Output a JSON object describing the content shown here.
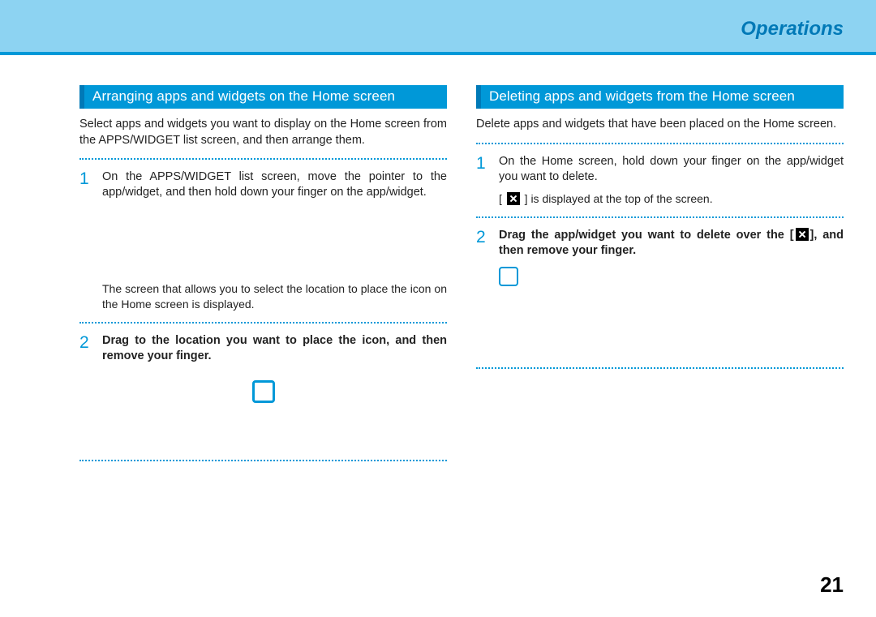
{
  "header": {
    "title": "Operations"
  },
  "page_number": "21",
  "left": {
    "heading": "Arranging apps and widgets on the Home screen",
    "intro": "Select apps and widgets you want to display on the Home screen from the APPS/WIDGET list screen, and then arrange them.",
    "step1_num": "1",
    "step1_text": "On the APPS/WIDGET list screen, move the pointer to the app/widget, and then hold down your finger on the app/widget.",
    "note": "The screen that allows you to select the location to place the icon on the Home screen is displayed.",
    "step2_num": "2",
    "step2_text": "Drag to the location you want to place the icon, and then remove your finger."
  },
  "right": {
    "heading": "Deleting apps and widgets from the Home screen",
    "intro": "Delete apps and widgets that have been placed on the Home screen.",
    "step1_num": "1",
    "step1_text": "On the Home screen, hold down your finger on the app/widget you want to delete.",
    "note_prefix": "[ ",
    "note_suffix": " ] is displayed at the top of the screen.",
    "step2_num": "2",
    "step2_text_a": "Drag the app/widget you want to delete over the [",
    "step2_text_b": "], and then remove your finger."
  }
}
